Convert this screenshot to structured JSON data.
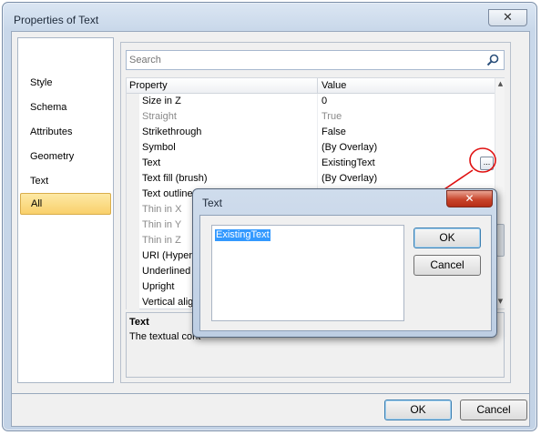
{
  "window": {
    "title": "Properties of Text",
    "close_glyph": "✕"
  },
  "sidebar": {
    "items": [
      {
        "label": "Style"
      },
      {
        "label": "Schema"
      },
      {
        "label": "Attributes"
      },
      {
        "label": "Geometry"
      },
      {
        "label": "Text"
      },
      {
        "label": "All"
      }
    ],
    "selected": "All"
  },
  "search": {
    "placeholder": "Search",
    "icon": "search-icon"
  },
  "grid": {
    "headers": {
      "property": "Property",
      "value": "Value"
    },
    "rows": [
      {
        "name": "Size in Z",
        "value": "0",
        "disabled": false
      },
      {
        "name": "Straight",
        "value": "True",
        "disabled": true
      },
      {
        "name": "Strikethrough",
        "value": "False",
        "disabled": false
      },
      {
        "name": "Symbol",
        "value": " (By Overlay)",
        "disabled": false
      },
      {
        "name": "Text",
        "value": "ExistingText",
        "disabled": false
      },
      {
        "name": "Text fill (brush)",
        "value": " (By Overlay)",
        "disabled": false
      },
      {
        "name": "Text outline",
        "value": "",
        "disabled": false
      },
      {
        "name": "Thin in X",
        "value": "",
        "disabled": true
      },
      {
        "name": "Thin in Y",
        "value": "",
        "disabled": true
      },
      {
        "name": "Thin in Z",
        "value": "",
        "disabled": true
      },
      {
        "name": "URI (Hyperlin",
        "value": "",
        "disabled": false
      },
      {
        "name": "Underlined",
        "value": "",
        "disabled": false
      },
      {
        "name": "Upright",
        "value": "",
        "disabled": false
      },
      {
        "name": "Vertical align",
        "value": "",
        "disabled": false
      }
    ],
    "ellipsis_label": "..."
  },
  "description": {
    "title": "Text",
    "text": "The textual cont"
  },
  "buttons": {
    "ok": "OK",
    "cancel": "Cancel"
  },
  "text_dialog": {
    "title": "Text",
    "close_glyph": "✕",
    "value": "ExistingText",
    "ok": "OK",
    "cancel": "Cancel"
  },
  "colors": {
    "annotation_red": "#e01010",
    "selection_blue": "#3399ff",
    "selected_item": "#f9d06b"
  }
}
